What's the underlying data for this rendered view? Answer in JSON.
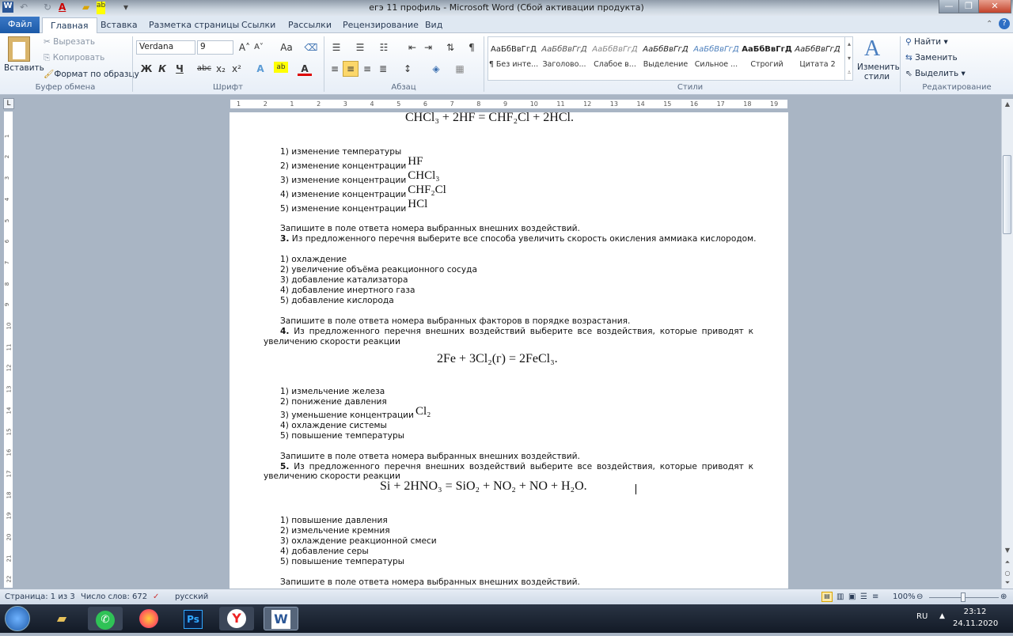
{
  "window": {
    "title": "егэ 11 профиль - Microsoft Word (Сбой активации продукта)",
    "minimize": "—",
    "maximize": "❐",
    "close": "✕"
  },
  "tabs": [
    "Файл",
    "Главная",
    "Вставка",
    "Разметка страницы",
    "Ссылки",
    "Рассылки",
    "Рецензирование",
    "Вид"
  ],
  "active_tab": "Главная",
  "ribbon": {
    "clipboard": {
      "paste": "Вставить",
      "cut": "Вырезать",
      "copy": "Копировать",
      "format_painter": "Формат по образцу",
      "label": "Буфер обмена"
    },
    "font": {
      "name": "Verdana",
      "size": "9",
      "label": "Шрифт",
      "bold": "Ж",
      "italic": "К",
      "underline": "Ч",
      "strike": "abc",
      "subscript": "x₂",
      "superscript": "x²",
      "grow": "A˄",
      "shrink": "A˅",
      "case": "Aa"
    },
    "paragraph": {
      "label": "Абзац",
      "pilcrow": "¶",
      "align_selected": "center"
    },
    "styles": {
      "label": "Стили",
      "items": [
        {
          "preview": "АаБбВвГгД",
          "name": "¶ Без инте..."
        },
        {
          "preview": "АаБбВвГгД",
          "name": "Заголово..."
        },
        {
          "preview": "АаБбВвГгД",
          "name": "Слабое в..."
        },
        {
          "preview": "АаБбВвГгД",
          "name": "Выделение"
        },
        {
          "preview": "АаБбВвГгД",
          "name": "Сильное ..."
        },
        {
          "preview": "АаБбВвГгД",
          "name": "Строгий"
        },
        {
          "preview": "АаБбВвГгД",
          "name": "Цитата 2"
        }
      ],
      "change_styles": "Изменить стили"
    },
    "editing": {
      "label": "Редактирование",
      "find": "Найти",
      "replace": "Заменить",
      "select": "Выделить"
    }
  },
  "ruler": {
    "marks": [
      "1",
      "2",
      "1",
      "2",
      "3",
      "4",
      "5",
      "6",
      "7",
      "8",
      "9",
      "10",
      "11",
      "12",
      "13",
      "14",
      "15",
      "16",
      "17",
      "18",
      "19"
    ]
  },
  "document": {
    "formula1": "CHCl₃ + 2HF = CHF₂Cl + 2HCl.",
    "q2_items": [
      {
        "text": "1) изменение температуры",
        "formula": ""
      },
      {
        "text": "2) изменение концентрации",
        "formula": "HF"
      },
      {
        "text": "3) изменение концентрации",
        "formula": "CHCl₃"
      },
      {
        "text": "4) изменение концентрации",
        "formula": "CHF₂Cl"
      },
      {
        "text": "5) изменение концентрации",
        "formula": "HCl"
      }
    ],
    "q2_answer": "Запишите в поле ответа номера выбранных внешних воздействий.",
    "q3_num": "3.",
    "q3_text": "Из предложенного перечня выберите все способа увеличить скорость окисления аммиака кислородом.",
    "q3_items": [
      "1) охлаждение",
      "2) увеличение объёма реакционного сосуда",
      "3) добавление катализатора",
      "4) добавление инертного газа",
      "5) добавление кислорода"
    ],
    "q3_answer": "Запишите в поле ответа номера выбранных факторов в порядке возрастания.",
    "q4_num": "4.",
    "q4_text": "Из предложенного перечня внешних воздействий выберите все воздействия, которые приводят к",
    "q4_text2": "увеличению скорости реакции",
    "formula2": "2Fe + 3Cl₂(г) = 2FeCl₃.",
    "q4_items": [
      {
        "text": "1) измельчение железа",
        "formula": ""
      },
      {
        "text": "2) понижение давления",
        "formula": ""
      },
      {
        "text": "3) уменьшение концентрации",
        "formula": "Cl₂"
      },
      {
        "text": "4) охлаждение системы",
        "formula": ""
      },
      {
        "text": "5) повышение температуры",
        "formula": ""
      }
    ],
    "q4_answer": "Запишите в поле ответа номера выбранных внешних воздействий.",
    "q5_num": "5.",
    "q5_text": "Из предложенного перечня внешних воздействий выберите все воздействия, которые приводят к",
    "q5_text2": "увеличению скорости реакции",
    "formula3": "Si + 2HNO₃ = SiO₂ + NO₂ + NO + H₂O.",
    "q5_items": [
      "1) повышение давления",
      "2) измельчение кремния",
      "3) охлаждение реакционной смеси",
      "4) добавление серы",
      "5) повышение температуры"
    ],
    "q5_answer": "Запишите в поле ответа номера выбранных внешних воздействий."
  },
  "status": {
    "page": "Страница: 1 из 3",
    "words": "Число слов: 672",
    "language": "русский",
    "zoom": "100%",
    "zoom_percent": 100
  },
  "taskbar": {
    "apps": [
      "start",
      "explorer",
      "whatsapp",
      "firefox",
      "photoshop",
      "yandex",
      "word"
    ],
    "lang": "RU",
    "time": "23:12",
    "date": "24.11.2020"
  }
}
